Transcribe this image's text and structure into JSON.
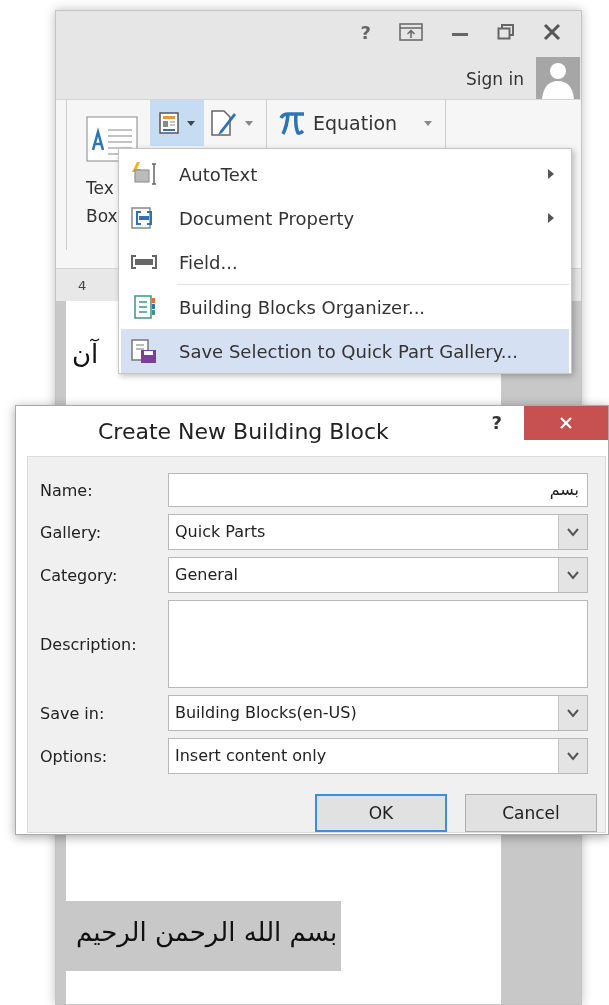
{
  "window": {
    "help": "?",
    "sign_in": "Sign in"
  },
  "ribbon": {
    "text_box": [
      "Tex",
      "Box"
    ],
    "quick_parts": {
      "pressed": true
    },
    "equation": "Equation"
  },
  "ruler": {
    "mark": "4"
  },
  "document": {
    "lines": [
      {
        "text": "آن",
        "selected": false
      },
      {
        "text": "بسم الله الرحمن الرحيم",
        "selected": true
      }
    ]
  },
  "menu": {
    "items": [
      {
        "label": "AutoText",
        "submenu": true,
        "separator_before": false,
        "selected": false
      },
      {
        "label": "Document Property",
        "submenu": true,
        "separator_before": false,
        "selected": false
      },
      {
        "label": "Field...",
        "submenu": false,
        "separator_before": false,
        "selected": false
      },
      {
        "label": "Building Blocks Organizer...",
        "submenu": false,
        "separator_before": true,
        "selected": false
      },
      {
        "label": "Save Selection to Quick Part Gallery...",
        "submenu": false,
        "separator_before": false,
        "selected": true
      }
    ]
  },
  "dialog": {
    "title": "Create New Building Block",
    "help": "?",
    "fields": [
      {
        "label": "Name:",
        "kind": "text",
        "value": "بسم"
      },
      {
        "label": "Gallery:",
        "kind": "combo",
        "value": "Quick Parts"
      },
      {
        "label": "Category:",
        "kind": "combo",
        "value": "General"
      },
      {
        "label": "Description:",
        "kind": "textarea"
      },
      {
        "label": "Save in:",
        "kind": "combo",
        "value": "Building Blocks(en-US)"
      },
      {
        "label": "Options:",
        "kind": "combo",
        "value": "Insert content only"
      }
    ],
    "buttons": [
      {
        "label": "OK",
        "default": true
      },
      {
        "label": "Cancel",
        "default": false
      }
    ]
  }
}
